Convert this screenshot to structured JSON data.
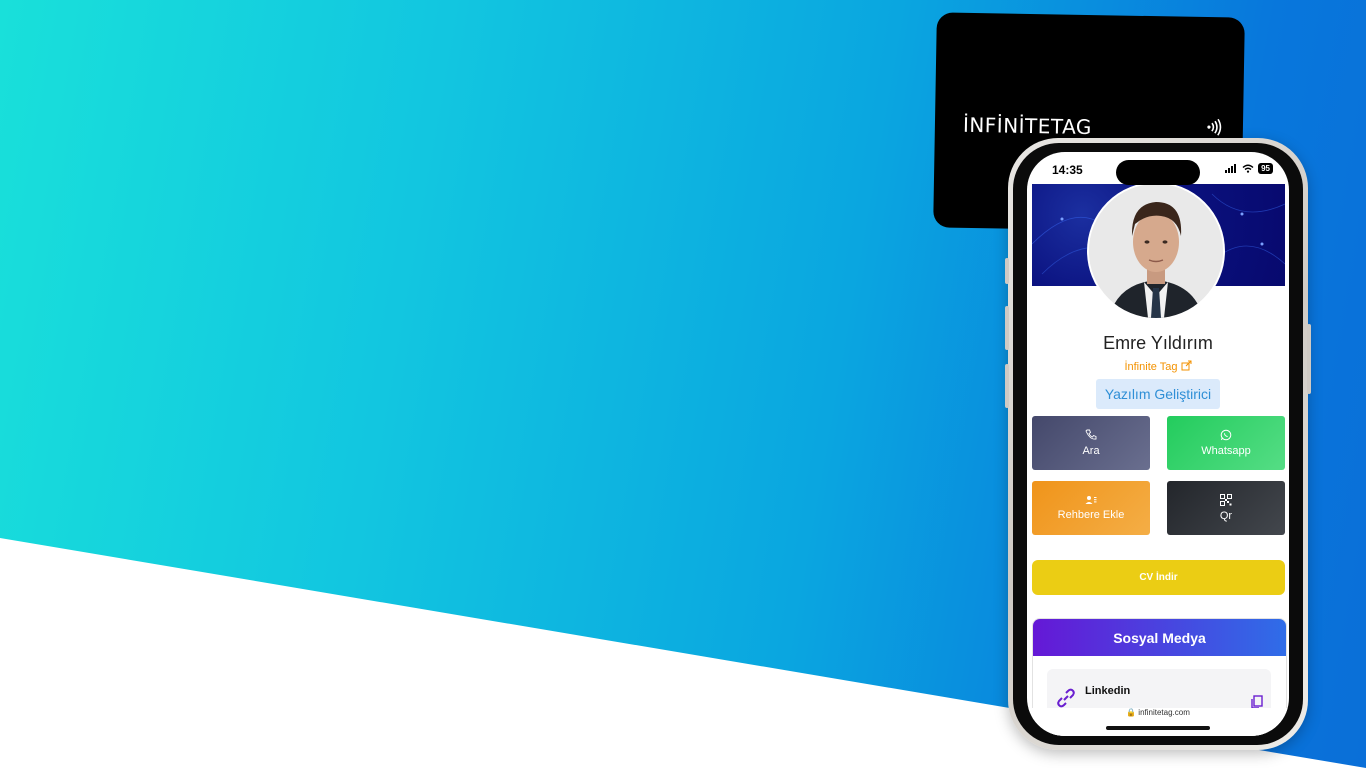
{
  "card": {
    "brand": "İNFİNİTETAG"
  },
  "status": {
    "time": "14:35",
    "battery": "95"
  },
  "profile": {
    "name": "Emre Yıldırım",
    "company": "İnfinite Tag",
    "title": "Yazılım Geliştirici"
  },
  "actions": [
    {
      "label": "Ara",
      "icon": "phone-icon"
    },
    {
      "label": "Whatsapp",
      "icon": "whatsapp-icon"
    },
    {
      "label": "Rehbere Ekle",
      "icon": "add-contact-icon"
    },
    {
      "label": "Qr",
      "icon": "qr-icon"
    }
  ],
  "cv_button": "CV İndir",
  "social": {
    "heading": "Sosyal Medya",
    "items": [
      {
        "label": "Linkedin",
        "icon": "link-icon"
      }
    ]
  },
  "browser": {
    "url": "infinitetag.com"
  },
  "colors": {
    "whatsapp": "#25D366",
    "call": "#4a4e6f",
    "add_contact": "#f0941a",
    "qr": "#2a2d33",
    "cv": "#ebcd14",
    "social_gradient_start": "#6518d6",
    "social_gradient_end": "#2f6de8",
    "company": "#f39200",
    "title_text": "#2f8fd6"
  }
}
